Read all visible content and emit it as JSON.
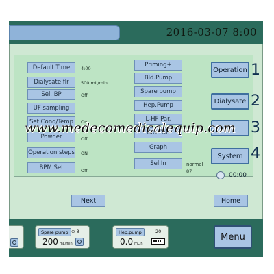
{
  "header": {
    "datetime": "2016-03-07   8:00"
  },
  "left_column": [
    {
      "label": "Default Time",
      "value": "4:00"
    },
    {
      "label": "Dialysate flr",
      "value": "500  mL/min"
    },
    {
      "label": "Sel. BP",
      "value": "Off"
    },
    {
      "label": "UF sampling",
      "value": ""
    },
    {
      "label": "Set Cond/Temp",
      "value": "On"
    },
    {
      "label": "Powder",
      "value": "Off"
    },
    {
      "label": "Operation steps",
      "value": "ON"
    },
    {
      "label": "BPM Set",
      "value": "Off"
    }
  ],
  "middle_column": [
    {
      "label": "Priming+"
    },
    {
      "label": "Bld.Pump"
    },
    {
      "label": "Spare pump"
    },
    {
      "label": "Hep.Pump"
    },
    {
      "label": "L-HF Par."
    },
    {
      "label": "BIO Par."
    },
    {
      "label": "Graph"
    },
    {
      "label": "Sel In",
      "value": "normal",
      "value2": "87"
    }
  ],
  "side_menu": [
    {
      "label": "Operation",
      "number": "1"
    },
    {
      "label": "Dialysate",
      "number": "2"
    },
    {
      "label": "",
      "number": "3"
    },
    {
      "label": "System",
      "number": "4"
    }
  ],
  "clock": {
    "time": "00:00",
    "icon": "clock-icon"
  },
  "nav": {
    "next_label": "Next",
    "home_label": "Home"
  },
  "status_bar": {
    "spare_pump": {
      "label": "Spare pump",
      "value": "200",
      "unit": "mL/min",
      "count": "8"
    },
    "hep_pump": {
      "label": "Hep.pump",
      "value": "0.0",
      "unit": "mL/h",
      "count": "20"
    },
    "menu_label": "Menu"
  },
  "watermark": "www.medecomedicalequip.com",
  "colors": {
    "screen_bg": "#cfe8d3",
    "top_bar": "#2b6b5c",
    "button_blue": "#a9c5e4",
    "button_border": "#3f6f9f"
  }
}
